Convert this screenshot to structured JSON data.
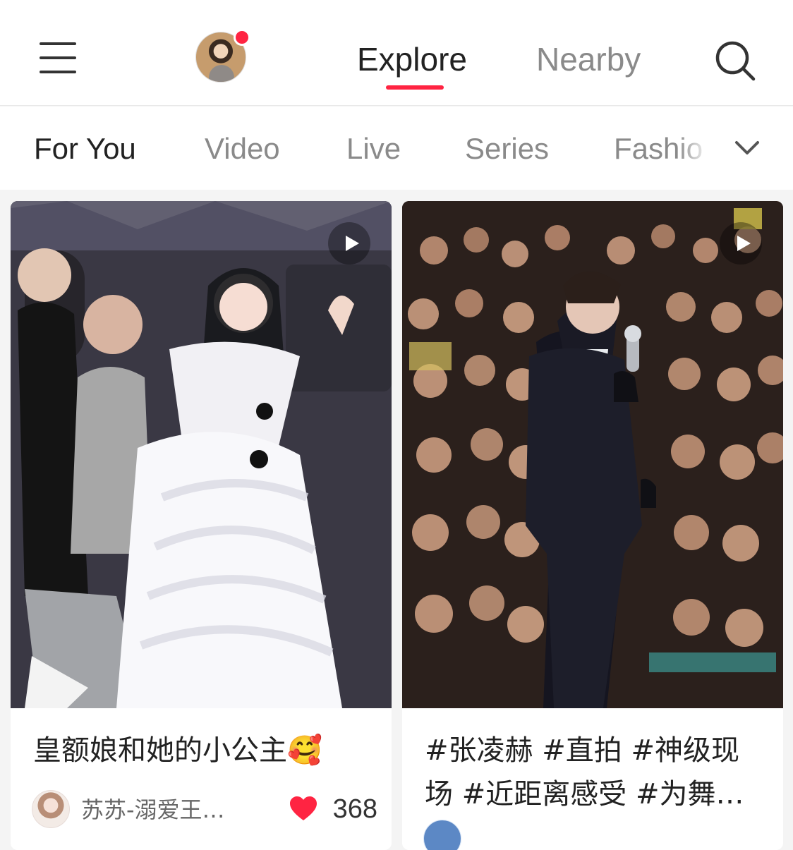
{
  "header": {
    "main_tabs": [
      {
        "label": "Explore",
        "active": true
      },
      {
        "label": "Nearby",
        "active": false
      }
    ],
    "accent_color": "#ff2442"
  },
  "categories": {
    "items": [
      "For You",
      "Video",
      "Live",
      "Series",
      "Fashio"
    ],
    "active": "For You"
  },
  "feed": [
    {
      "title": "皇额娘和她的小公主🥰",
      "author": "苏苏-溺爱王…",
      "likes": "368",
      "media_type": "video"
    },
    {
      "title": "#张凌赫 #直拍 #神级现场 #近距离感受 #为舞…",
      "author": "",
      "likes": "",
      "media_type": "video"
    }
  ],
  "icons": {
    "menu": "menu-icon",
    "search": "search-icon",
    "expand": "chevron-down-icon",
    "play": "play-icon",
    "like": "heart-icon"
  }
}
